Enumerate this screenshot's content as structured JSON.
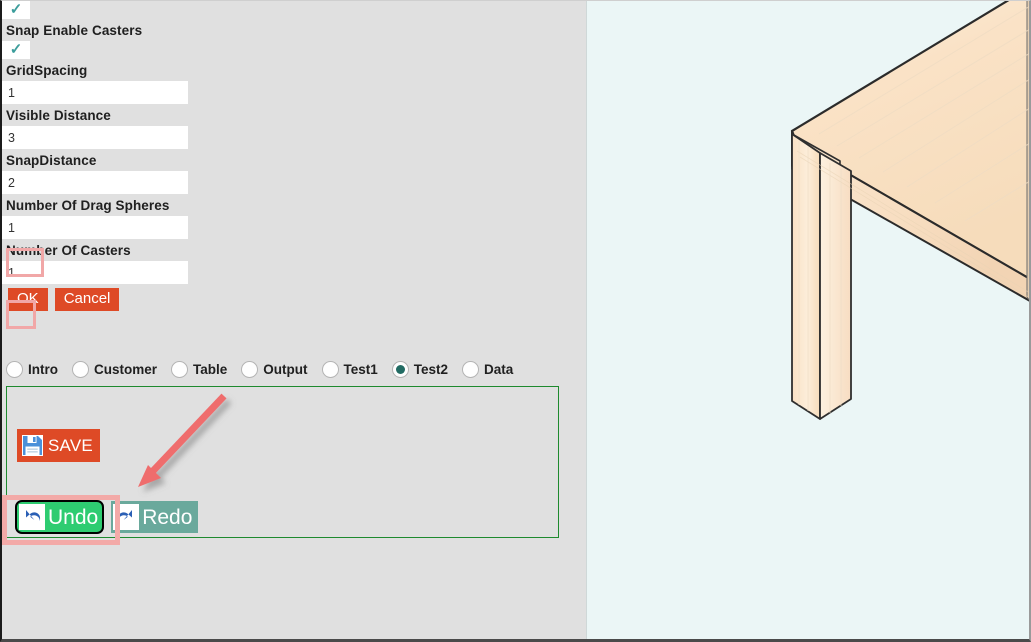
{
  "window": {
    "background_color": "#e0e0e0",
    "viewport_color": "#ebf6f6"
  },
  "form": {
    "checkbox_top": {
      "name": "snap-enable-casters-top-checkbox",
      "checked": true,
      "glyph": "✓"
    },
    "label_snap_enable_casters": "Snap Enable Casters",
    "checkbox_second": {
      "name": "snap-enable-casters-checkbox",
      "checked": true,
      "glyph": "✓"
    },
    "fields": [
      {
        "label": "GridSpacing",
        "value": "1",
        "highlighted": false
      },
      {
        "label": "Visible Distance",
        "value": "3",
        "highlighted": false
      },
      {
        "label": "SnapDistance",
        "value": "2",
        "highlighted": false
      },
      {
        "label": "Number Of Drag Spheres",
        "value": "1",
        "highlighted": true
      },
      {
        "label": "Number Of Casters",
        "value": "1",
        "highlighted": true
      }
    ],
    "buttons": {
      "ok_label": "OK",
      "cancel_label": "Cancel",
      "color": "#de4a26"
    }
  },
  "radios": {
    "selected": "Test2",
    "selected_color": "#226b63",
    "items": [
      {
        "label": "Intro",
        "checked": false
      },
      {
        "label": "Customer",
        "checked": false
      },
      {
        "label": "Table",
        "checked": false
      },
      {
        "label": "Output",
        "checked": false
      },
      {
        "label": "Test1",
        "checked": false
      },
      {
        "label": "Test2",
        "checked": true
      },
      {
        "label": "Data",
        "checked": false
      }
    ]
  },
  "action_panel": {
    "border_color": "#1e8a2e",
    "save": {
      "label": "SAVE",
      "icon": "floppy-disk-icon",
      "color": "#de4a26"
    },
    "undo": {
      "label": "Undo",
      "icon": "undo-arrow-icon",
      "color": "#2ecc71",
      "focused": true
    },
    "redo": {
      "label": "Redo",
      "icon": "redo-arrow-icon",
      "color": "#6aa99c",
      "focused": false
    }
  },
  "annotations": {
    "arrow": {
      "color": "#ef6d6d",
      "points_to": "undo-button",
      "direction": "down-left"
    },
    "highlight_color": "#f3aaa8"
  },
  "viewport": {
    "object": "wooden-table-3d",
    "background_color": "#ebf6f6",
    "wood_color": "#fbe6cc"
  }
}
